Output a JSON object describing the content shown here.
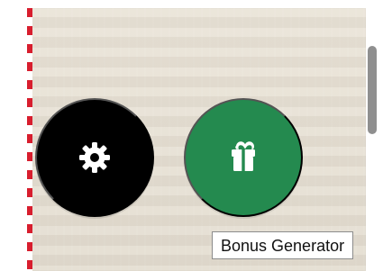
{
  "controls": {
    "settings": {
      "icon": "gear-icon",
      "color": "#000000"
    },
    "bonus_generator": {
      "icon": "gift-icon",
      "color": "#248a4f",
      "tooltip": "Bonus Generator"
    }
  },
  "colors": {
    "dashed_edge": "#d7192a",
    "background_panel": "#e8e1d4",
    "scrollbar_thumb": "#8f8f8f",
    "tooltip_border": "#8c8c8c"
  }
}
